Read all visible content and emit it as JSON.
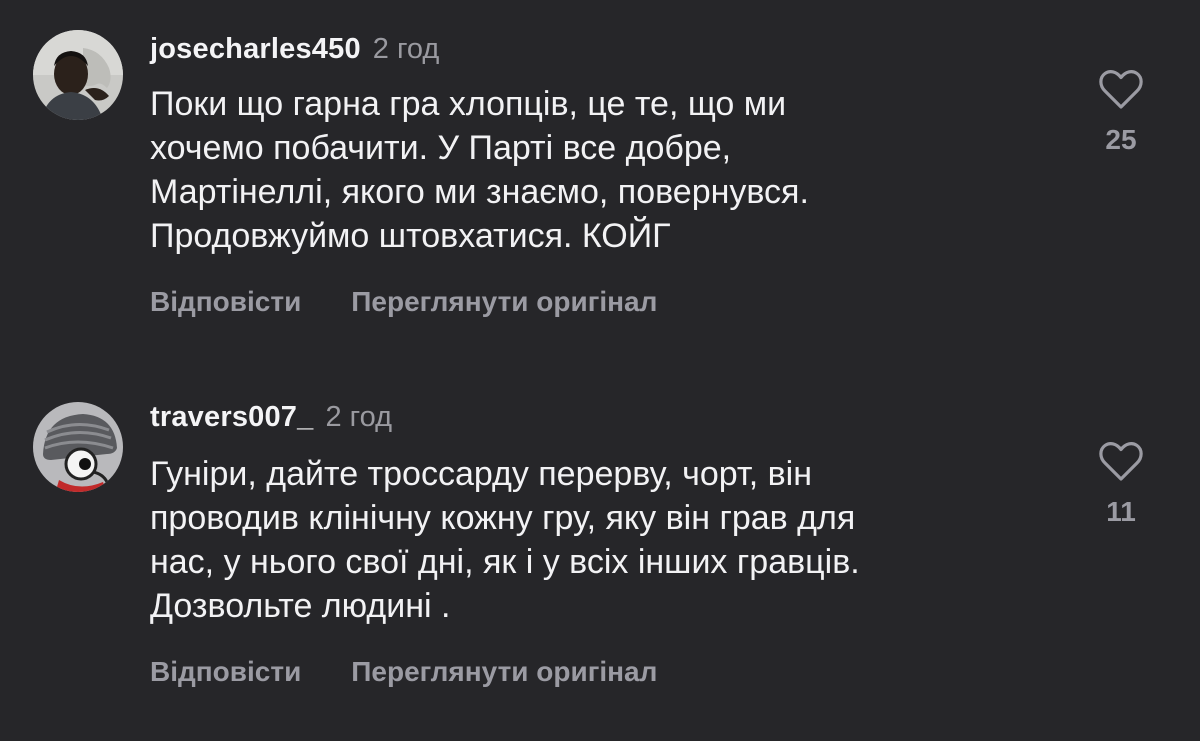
{
  "comments": [
    {
      "username": "josecharles450",
      "time": "2 год",
      "text_lines": [
        "Поки що гарна гра хлопців, це те, що ми",
        "хочемо побачити. У Парті все добре,",
        "Мартінеллі, якого ми знаємо, повернувся.",
        "Продовжуймо штовхатися. КОЙГ"
      ],
      "reply_label": "Відповісти",
      "see_original_label": "Переглянути оригінал",
      "likes": "25",
      "avatar_icon": "user-photo-avatar"
    },
    {
      "username": "travers007_",
      "time": "2 год",
      "text_lines": [
        "Гуніри, дайте троссарду перерву, чорт, він",
        "проводив клінічну кожну гру, яку він грав для",
        "нас, у нього свої дні, як і у всіх інших гравців.",
        "Дозвольте людині ."
      ],
      "reply_label": "Відповісти",
      "see_original_label": "Переглянути оригінал",
      "likes": "11",
      "avatar_icon": "cartoon-character-avatar"
    }
  ],
  "colors": {
    "background": "#262629",
    "primary_text": "#f2f2f4",
    "secondary_text": "#9b9ba3"
  },
  "icons": {
    "like": "heart-outline-icon"
  }
}
